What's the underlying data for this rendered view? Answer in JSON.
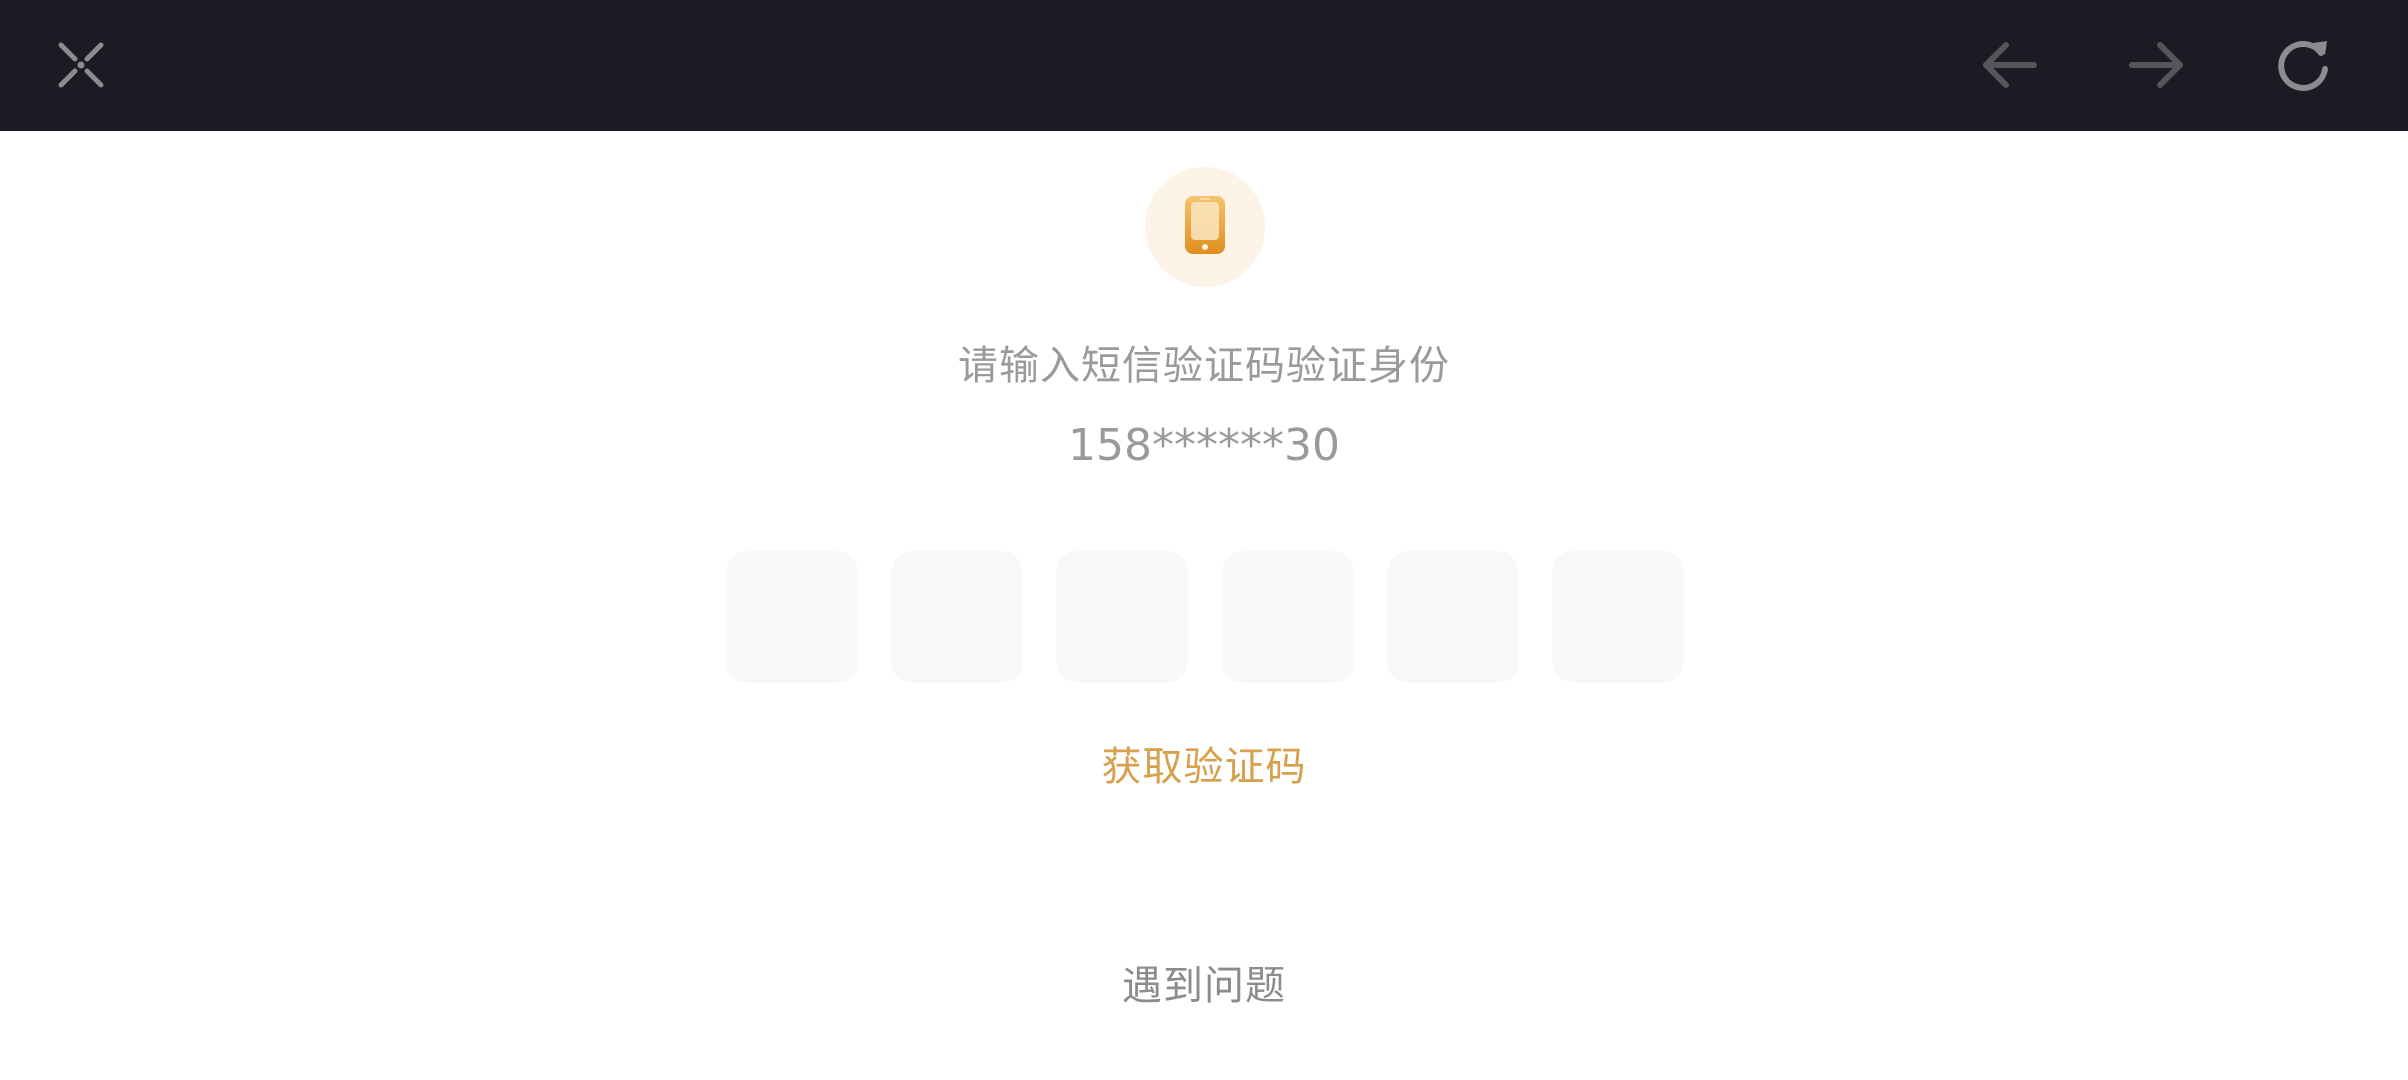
{
  "toolbar": {
    "close_icon": "close-icon",
    "back_icon": "arrow-left-icon",
    "forward_icon": "arrow-right-icon",
    "refresh_icon": "refresh-icon",
    "background": "#1b1b24"
  },
  "verification": {
    "icon": "phone-icon",
    "title": "请输入短信验证码验证身份",
    "phone": "158******30",
    "code_boxes": [
      "",
      "",
      "",
      "",
      "",
      ""
    ],
    "get_code_label": "获取验证码",
    "problem_label": "遇到问题",
    "accent": "#d6a04c"
  }
}
